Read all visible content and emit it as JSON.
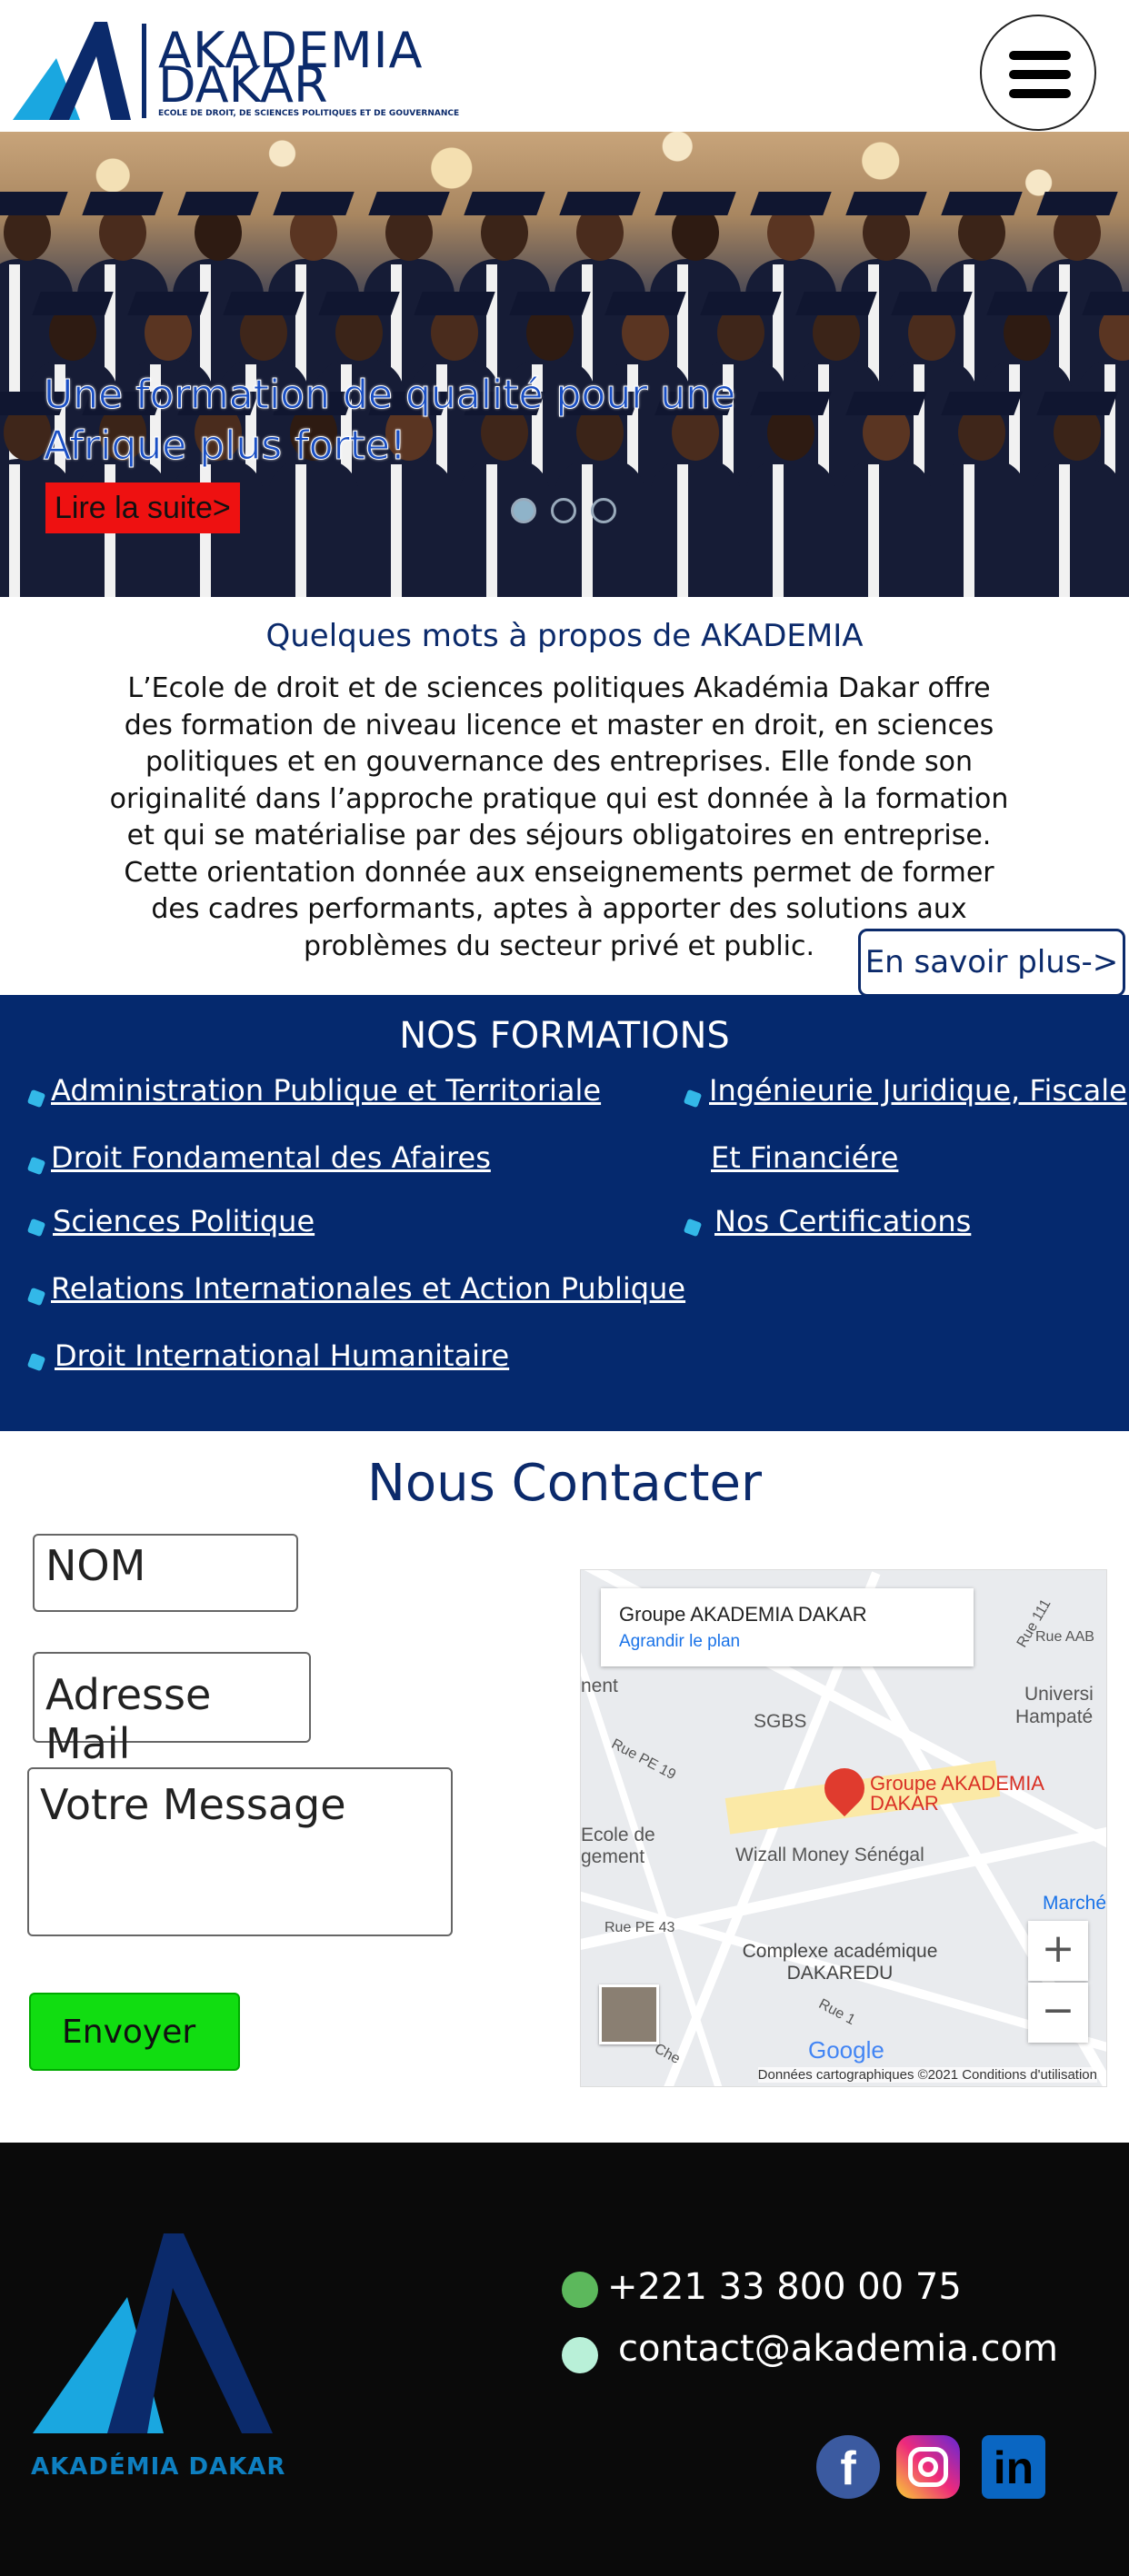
{
  "header": {
    "logo_line1": "AKADEMIA",
    "logo_line2": "DAKAR",
    "logo_tagline": "ECOLE DE DROIT, DE SCIENCES POLITIQUES ET DE GOUVERNANCE",
    "menu_icon": "hamburger-menu-icon"
  },
  "hero": {
    "title": "Une formation de qualité pour une Afrique plus forte!",
    "button_label": "Lire la suite>",
    "slides": 3,
    "active_slide": 1
  },
  "about": {
    "title": "Quelques mots à propos de AKADEMIA",
    "text": "L’Ecole de droit et de sciences politiques Akadémia Dakar offre des formation de niveau licence et master en droit, en sciences politiques et en gouvernance des entreprises. Elle fonde son originalité dans l’approche pratique qui est donnée à la formation et qui se matérialise par des séjours obligatoires en entreprise. Cette orientation donnée aux enseignements permet de former des cadres performants, aptes à apporter des solutions aux problèmes du secteur privé et public.",
    "more_label": "En savoir plus->"
  },
  "formations": {
    "title": "NOS FORMATIONS",
    "left": [
      "Administration Publique et Territoriale",
      "Droit Fondamental des Afaires",
      "Sciences Politique",
      "Relations Internationales et Action Publique",
      "Droit International Humanitaire"
    ],
    "right": [
      "Ingénieurie Juridique, Fiscale",
      "Et Financiére",
      "Nos Certifications"
    ]
  },
  "contact": {
    "title": "Nous Contacter",
    "name_placeholder": "NOM",
    "email_placeholder": "Adresse Mail",
    "message_placeholder": "Votre Message",
    "send_label": "Envoyer"
  },
  "map": {
    "card_title": "Groupe AKADEMIA DAKAR",
    "card_link": "Agrandir le plan",
    "pin_label": "Groupe AKADEMIA DAKAR",
    "labels": [
      "SGBS",
      "Rue PE 19",
      "Wizall Money Sénégal",
      "Rue PE 43",
      "Complexe académique DAKAREDU",
      "Rue AAB",
      "Rue 111",
      "Universi",
      "Hampaté",
      "Marché",
      "Ecole de",
      "gement",
      "nent",
      "Rue 1",
      "Che"
    ],
    "google": "Google",
    "footer": "Données cartographiques ©2021   Conditions d'utilisation",
    "zoom_in": "+",
    "zoom_out": "−"
  },
  "footer": {
    "logo_text": "AKADÉMIA DAKAR",
    "phone": "+221 33 800 00 75",
    "email": "contact@akademia.com",
    "social": [
      "facebook-icon",
      "instagram-icon",
      "linkedin-icon"
    ],
    "colors": {
      "background": "#0a0a0a",
      "brand_blue": "#0b2a6b",
      "accent_cyan": "#1aa7e0"
    }
  }
}
